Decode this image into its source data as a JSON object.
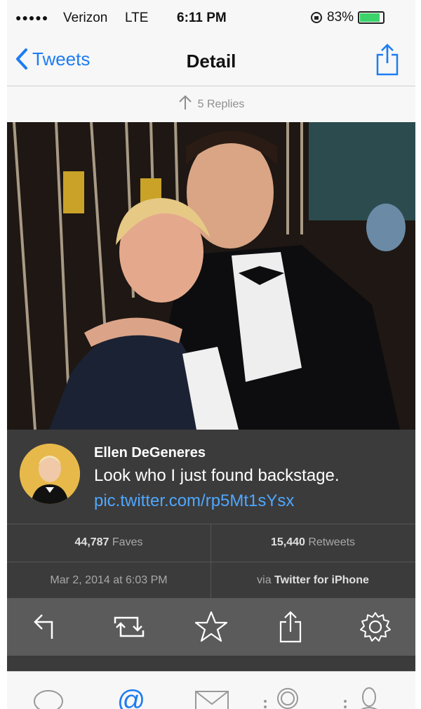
{
  "status": {
    "carrier": "Verizon",
    "network": "LTE",
    "time": "6:11 PM",
    "battery": "83%",
    "battery_level": 0.83
  },
  "nav": {
    "back_label": "Tweets",
    "title": "Detail"
  },
  "replies": {
    "label": "5 Replies"
  },
  "tweet": {
    "author": "Ellen DeGeneres",
    "text": "Look who I just found backstage.",
    "link": "pic.twitter.com/rp5Mt1sYsx"
  },
  "stats": {
    "faves_count": "44,787",
    "faves_label": "Faves",
    "retweets_count": "15,440",
    "retweets_label": "Retweets",
    "date": "Mar 2, 2014 at 6:03 PM",
    "via_prefix": "via",
    "via_app": "Twitter for iPhone"
  },
  "actions": [
    "reply-icon",
    "retweet-icon",
    "favorite-icon",
    "share-icon",
    "settings-icon"
  ],
  "tabs": [
    "timeline-icon",
    "mentions-icon",
    "messages-icon",
    "search-icon",
    "profile-icon"
  ],
  "colors": {
    "accent": "#1e7cf2",
    "link": "#4ea7ff",
    "panel": "#3b3b3b",
    "actions_bar": "#5b5b5b"
  }
}
